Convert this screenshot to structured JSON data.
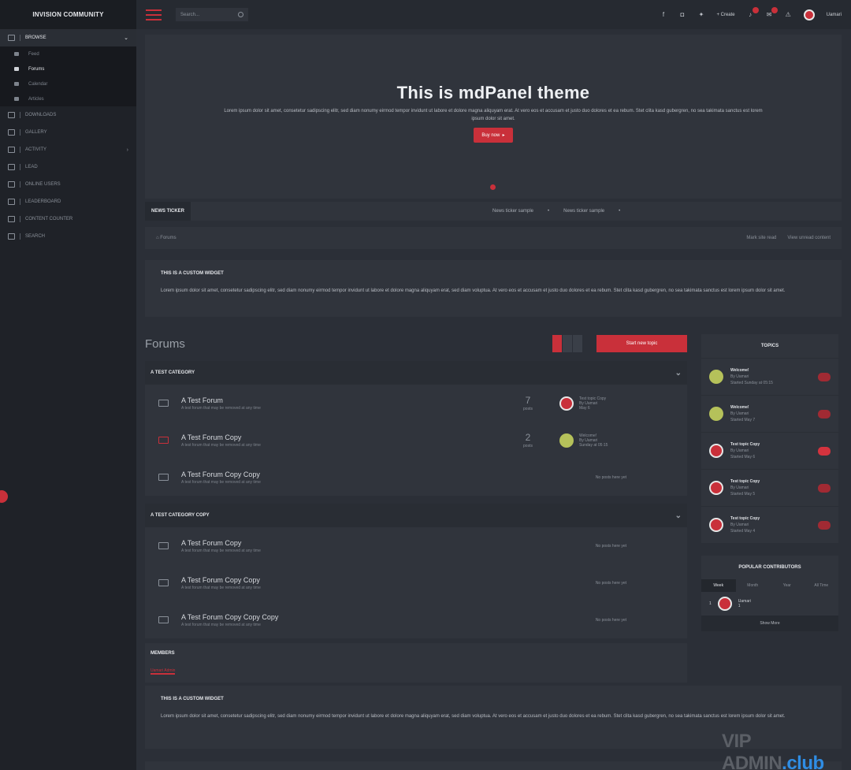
{
  "brand": "INVISION COMMUNITY",
  "sidebar": {
    "items": [
      {
        "label": "BROWSE",
        "icon": "monitor-icon",
        "open": true
      },
      {
        "label": "DOWNLOADS",
        "icon": "download-icon"
      },
      {
        "label": "GALLERY",
        "icon": "camera-icon"
      },
      {
        "label": "ACTIVITY",
        "icon": "chart-icon",
        "arrow": "›"
      },
      {
        "label": "LEAD",
        "icon": "trophy-icon"
      },
      {
        "label": "ONLINE USERS",
        "icon": "user-icon"
      },
      {
        "label": "LEADERBOARD",
        "icon": "list-icon"
      },
      {
        "label": "CONTENT COUNTER",
        "icon": "bar-icon"
      },
      {
        "label": "SEARCH",
        "icon": "search-icon"
      }
    ],
    "browse_arrow": "⌄",
    "sub": [
      "Feed",
      "Forums",
      "Calendar",
      "Articles"
    ]
  },
  "header": {
    "search_placeholder": "Search...",
    "create": "+ Create",
    "user": "Uamari"
  },
  "hero": {
    "title": "This is mdPanel theme",
    "text": "Lorem ipsum dolor sit amet, consetetur sadipscing elitr, sed diam nonumy eirmod tempor invidunt ut labore et dolore magna aliquyam erat. At vero eos et accusam et justo duo dolores et ea rebum. Stet clita kasd gubergren, no sea takimata sanctus est lorem ipsum dolor sit amet.",
    "button": "Buy now"
  },
  "ticker": {
    "label": "NEWS TICKER",
    "items": [
      "News ticker sample",
      "News ticker sample"
    ]
  },
  "breadcrumb": {
    "home": "⌂ Forums",
    "mark_read": "Mark site read",
    "unread": "View unread content"
  },
  "widget1": {
    "title": "THIS IS A CUSTOM WIDGET",
    "text": "Lorem ipsum dolor sit amet, consetetur sadipscing elitr, sed diam nonumy eirmod tempor invidunt ut labore et dolore magna aliquyam erat, sed diam voluptua. At vero eos et accusam et justo duo dolores et ea rebum. Stet clita kasd gubergren, no sea takimata sanctus est lorem ipsum dolor sit amet."
  },
  "forums": {
    "title": "Forums",
    "start_topic": "Start new topic",
    "categories": [
      {
        "name": "A TEST CATEGORY",
        "rows": [
          {
            "name": "A Test Forum",
            "desc": "A test forum that may be removed at any time",
            "count": "7",
            "count_label": "posts",
            "last_title": "Test topic Copy",
            "last_by": "By Uamari",
            "last_date": "May 6",
            "avatar": "red"
          },
          {
            "name": "A Test Forum Copy",
            "desc": "A test forum that may be removed at any time",
            "count": "2",
            "count_label": "posts",
            "last_title": "Welcome!",
            "last_by": "By Uamari",
            "last_date": "Sunday at 05:15",
            "avatar": "green"
          },
          {
            "name": "A Test Forum Copy Copy",
            "desc": "A test forum that may be removed at any time",
            "none": "No posts here yet"
          }
        ]
      },
      {
        "name": "A TEST CATEGORY COPY",
        "rows": [
          {
            "name": "A Test Forum Copy",
            "desc": "A test forum that may be removed at any time",
            "none": "No posts here yet"
          },
          {
            "name": "A Test Forum Copy Copy",
            "desc": "A test forum that may be removed at any time",
            "none": "No posts here yet"
          },
          {
            "name": "A Test Forum Copy Copy Copy",
            "desc": "A test forum that may be removed at any time",
            "none": "No posts here yet"
          }
        ]
      }
    ]
  },
  "members": {
    "title": "MEMBERS",
    "label": "Uamari",
    "rest": " Admin"
  },
  "topics": {
    "title": "TOPICS",
    "rows": [
      {
        "title": "Welcome!",
        "by": "By Uamari",
        "when": "Started Sunday at 05:15",
        "avatar": "green"
      },
      {
        "title": "Welcome!",
        "by": "By Uamari",
        "when": "Started May 7",
        "avatar": "green"
      },
      {
        "title": "Test topic Copy",
        "by": "By Uamari",
        "when": "Started May 6",
        "avatar": "red",
        "hot": true
      },
      {
        "title": "Test topic Copy",
        "by": "By Uamari",
        "when": "Started May 5",
        "avatar": "red"
      },
      {
        "title": "Test topic Copy",
        "by": "By Uamari",
        "when": "Started May 4",
        "avatar": "red"
      }
    ]
  },
  "popular": {
    "title": "POPULAR CONTRIBUTORS",
    "tabs": [
      "Week",
      "Month",
      "Year",
      "All Time"
    ],
    "rank": "1",
    "user": "Uamari",
    "points": "1",
    "show_more": "Show More"
  },
  "widget2": {
    "title": "THIS IS A CUSTOM WIDGET",
    "text": "Lorem ipsum dolor sit amet, consetetur sadipscing elitr, sed diam nonumy eirmod tempor invidunt ut labore et dolore magna aliquyam erat, sed diam voluptua. At vero eos et accusam et justo duo dolores et ea rebum. Stet clita kasd gubergren, no sea takimata sanctus est lorem ipsum dolor sit amet."
  },
  "watermark": {
    "a": "VIP ADMIN",
    "b": ".club"
  }
}
